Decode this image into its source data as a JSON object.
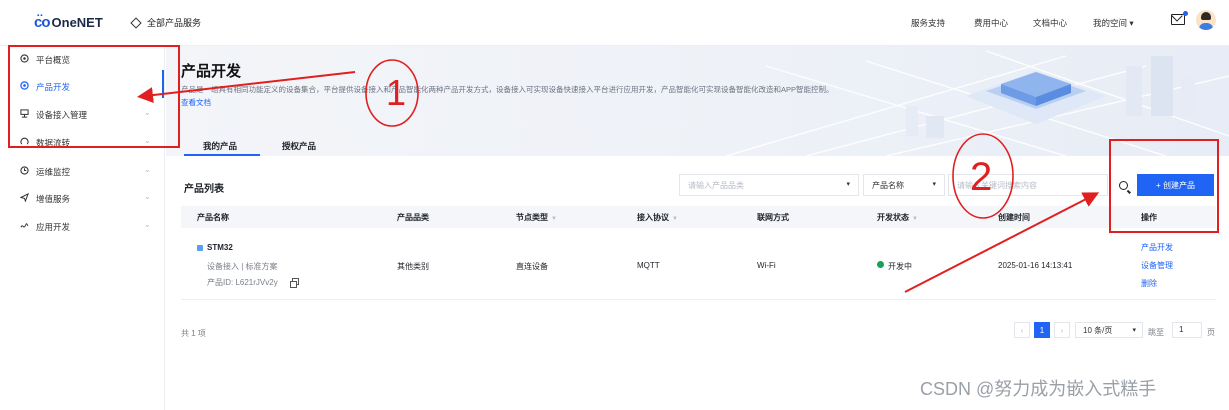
{
  "topbar": {
    "logo_text": "OneNET",
    "all_products": "全部产品服务",
    "nav": [
      "服务支持",
      "费用中心",
      "文档中心",
      "我的空间"
    ],
    "dropdown_caret": "▾"
  },
  "sidebar": {
    "items": [
      {
        "label": "平台概览"
      },
      {
        "label": "产品开发"
      },
      {
        "label": "设备接入管理"
      },
      {
        "label": "数据流转"
      },
      {
        "label": "运维监控"
      },
      {
        "label": "增值服务"
      },
      {
        "label": "应用开发"
      }
    ],
    "active_index": 1
  },
  "hero": {
    "title": "产品开发",
    "description": "产品是一组具有相同功能定义的设备集合，平台提供设备接入和产品智能化两种产品开发方式，设备接入可实现设备快速接入平台进行应用开发，产品智能化可实现设备智能化改造和APP智能控制。",
    "doc_link": "查看文档"
  },
  "tabs": [
    {
      "label": "我的产品",
      "active": true
    },
    {
      "label": "授权产品",
      "active": false
    }
  ],
  "list": {
    "title": "产品列表",
    "category_placeholder": "请输入产品品类",
    "field_select": "产品名称",
    "keyword_placeholder": "请输入关键词搜索内容",
    "create_button": "+ 创建产品"
  },
  "table": {
    "headers": [
      "产品名称",
      "产品品类",
      "节点类型",
      "接入协议",
      "联网方式",
      "开发状态",
      "创建时间",
      "操作"
    ],
    "rows": [
      {
        "name": "STM32",
        "sub": "设备接入 | 标准方案",
        "product_id": "产品ID: L621rJVv2y",
        "category": "其他类别",
        "node_type": "直连设备",
        "protocol": "MQTT",
        "network": "Wi-Fi",
        "status": "开发中",
        "created": "2025-01-16 14:13:41",
        "actions": [
          "产品开发",
          "设备管理",
          "删除"
        ]
      }
    ]
  },
  "pagination": {
    "total": "共 1 项",
    "prev": "‹",
    "current": "1",
    "next": "›",
    "page_size": "10 条/页",
    "goto_label": "跳至",
    "goto_value": "1",
    "page_suffix": "页"
  },
  "annotations": {
    "circle_1": "1",
    "circle_2": "2",
    "color": "#e02020"
  },
  "watermark": "CSDN @努力成为嵌入式糕手"
}
